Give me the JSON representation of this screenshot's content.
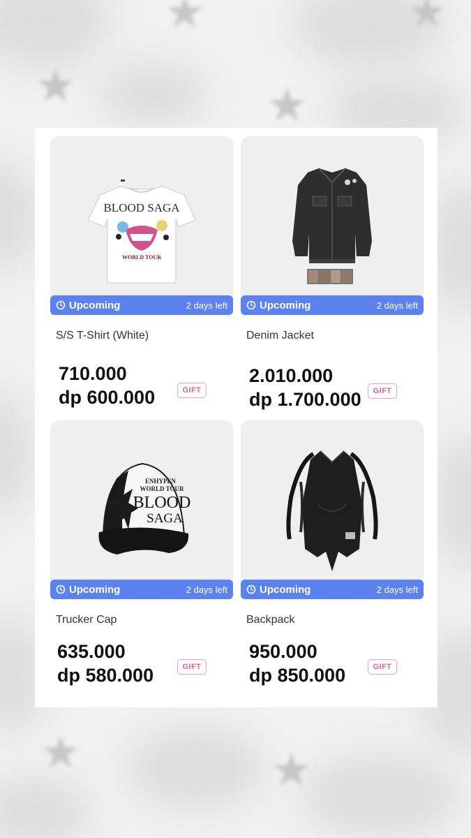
{
  "products": [
    {
      "name": "S/S T-Shirt (White)",
      "status": "Upcoming",
      "time_left": "2 days left",
      "price": "710.000",
      "dp_price": "dp 600.000",
      "gift_label": "GIFT",
      "image_text": {
        "line1": "BLOOD SAGA",
        "line2": "WORLD TOUR"
      }
    },
    {
      "name": "Denim Jacket",
      "status": "Upcoming",
      "time_left": "2 days left",
      "price": "2.010.000",
      "dp_price": "dp 1.700.000",
      "gift_label": "GIFT"
    },
    {
      "name": "Trucker Cap",
      "status": "Upcoming",
      "time_left": "2 days left",
      "price": "635.000",
      "dp_price": "dp 580.000",
      "gift_label": "GIFT",
      "image_text": {
        "line1": "ENHYPEN",
        "line2": "WORLD TOUR",
        "line3": "BLOOD",
        "line4": "SAGA"
      }
    },
    {
      "name": "Backpack",
      "status": "Upcoming",
      "time_left": "2 days left",
      "price": "950.000",
      "dp_price": "dp 850.000",
      "gift_label": "GIFT"
    }
  ],
  "colors": {
    "status_bar": "#5b82ef",
    "gift_border": "#ef9fbd",
    "gift_text": "#e06090",
    "card_bg": "#efefef",
    "page_bg": "#f1f1f1"
  },
  "icons": {
    "status": "clock-icon"
  }
}
